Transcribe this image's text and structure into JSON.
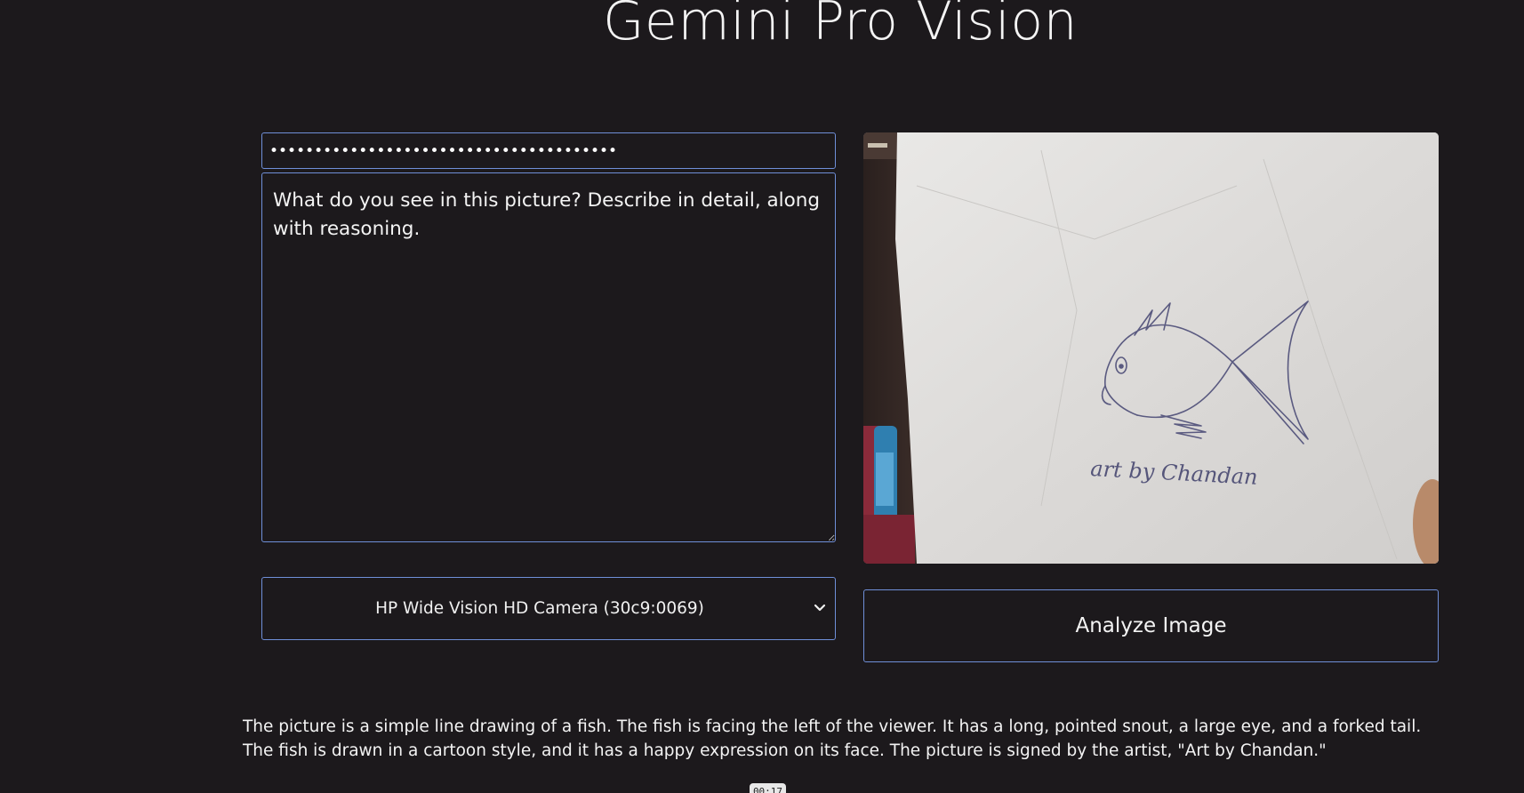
{
  "title": "Gemini Pro Vision",
  "api_key": {
    "value": "•••••••••••••••••••••••••••••••••••••••"
  },
  "prompt": {
    "value": "What do you see in this picture? Describe in detail, along with reasoning."
  },
  "camera_select": {
    "selected": "HP Wide Vision HD Camera (30c9:0069)"
  },
  "video_preview": {
    "drawing_caption": "art by Chandan"
  },
  "analyze_button": {
    "label": "Analyze Image"
  },
  "response_text": "The picture is a simple line drawing of a fish. The fish is facing the left of the viewer. It has a long, pointed snout, a large eye, and a forked tail. The fish is drawn in a cartoon style, and it has a happy expression on its face. The picture is signed by the artist, \"Art by Chandan.\"",
  "timer_badge": "00:17",
  "colors": {
    "background": "#1c191c",
    "border_accent": "#6f8fd8",
    "text": "#f4f4f4"
  }
}
